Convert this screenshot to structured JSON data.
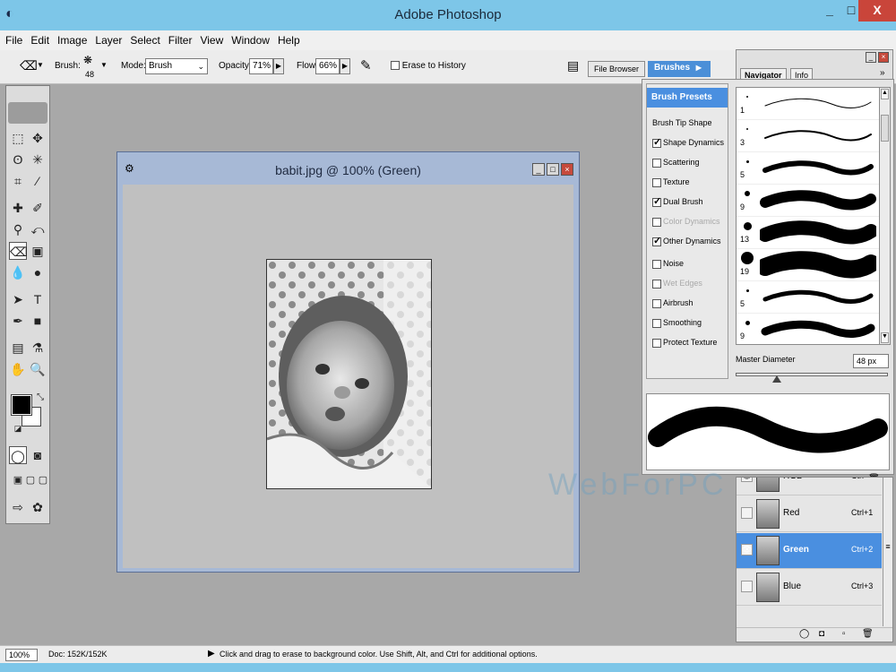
{
  "app": {
    "title": "Adobe Photoshop",
    "min": "_",
    "max": "□",
    "close": "X"
  },
  "menu": [
    "File",
    "Edit",
    "Image",
    "Layer",
    "Select",
    "Filter",
    "View",
    "Window",
    "Help"
  ],
  "options": {
    "brush_label": "Brush:",
    "brush_size": "48",
    "mode_label": "Mode:",
    "mode_value": "Brush",
    "opacity_label": "Opacity:",
    "opacity_value": "71%",
    "flow_label": "Flow:",
    "flow_value": "66%",
    "erase_history_label": "Erase to History"
  },
  "document": {
    "title": "babit.jpg @ 100% (Green)"
  },
  "palette_tabs": {
    "file_browser": "File Browser",
    "brushes": "Brushes"
  },
  "navigator": {
    "tab1": "Navigator",
    "tab2": "Info"
  },
  "brushes": {
    "presets_label": "Brush Presets",
    "items": [
      {
        "label": "Brush Tip Shape",
        "checkbox": false,
        "checked": false,
        "disabled": false
      },
      {
        "label": "Shape Dynamics",
        "checkbox": true,
        "checked": true,
        "disabled": false
      },
      {
        "label": "Scattering",
        "checkbox": true,
        "checked": false,
        "disabled": false
      },
      {
        "label": "Texture",
        "checkbox": true,
        "checked": false,
        "disabled": false
      },
      {
        "label": "Dual Brush",
        "checkbox": true,
        "checked": true,
        "disabled": false
      },
      {
        "label": "Color Dynamics",
        "checkbox": true,
        "checked": false,
        "disabled": true
      },
      {
        "label": "Other Dynamics",
        "checkbox": true,
        "checked": true,
        "disabled": false
      },
      {
        "label": "Noise",
        "checkbox": true,
        "checked": false,
        "disabled": false
      },
      {
        "label": "Wet Edges",
        "checkbox": true,
        "checked": false,
        "disabled": true
      },
      {
        "label": "Airbrush",
        "checkbox": true,
        "checked": false,
        "disabled": false
      },
      {
        "label": "Smoothing",
        "checkbox": true,
        "checked": false,
        "disabled": false
      },
      {
        "label": "Protect Texture",
        "checkbox": true,
        "checked": false,
        "disabled": false
      }
    ],
    "sizes": [
      "1",
      "3",
      "5",
      "9",
      "13",
      "19",
      "5",
      "9"
    ],
    "master_diameter_label": "Master Diameter",
    "master_diameter_value": "48 px",
    "master_diameter_fraction": 0.24
  },
  "channels": [
    {
      "name": "RGB",
      "shortcut": "Ctrl+~",
      "visible": true,
      "selected": false
    },
    {
      "name": "Red",
      "shortcut": "Ctrl+1",
      "visible": false,
      "selected": false
    },
    {
      "name": "Green",
      "shortcut": "Ctrl+2",
      "visible": true,
      "selected": true
    },
    {
      "name": "Blue",
      "shortcut": "Ctrl+3",
      "visible": false,
      "selected": false
    }
  ],
  "watermark": "WebForPC",
  "status": {
    "zoom": "100%",
    "doc": "Doc: 152K/152K",
    "hint": "Click and drag to erase to background color.  Use Shift, Alt, and Ctrl for additional options."
  },
  "colors": {
    "titlebar": "#7dc6e8",
    "selection": "#4a8fe0",
    "close": "#c9453a"
  }
}
